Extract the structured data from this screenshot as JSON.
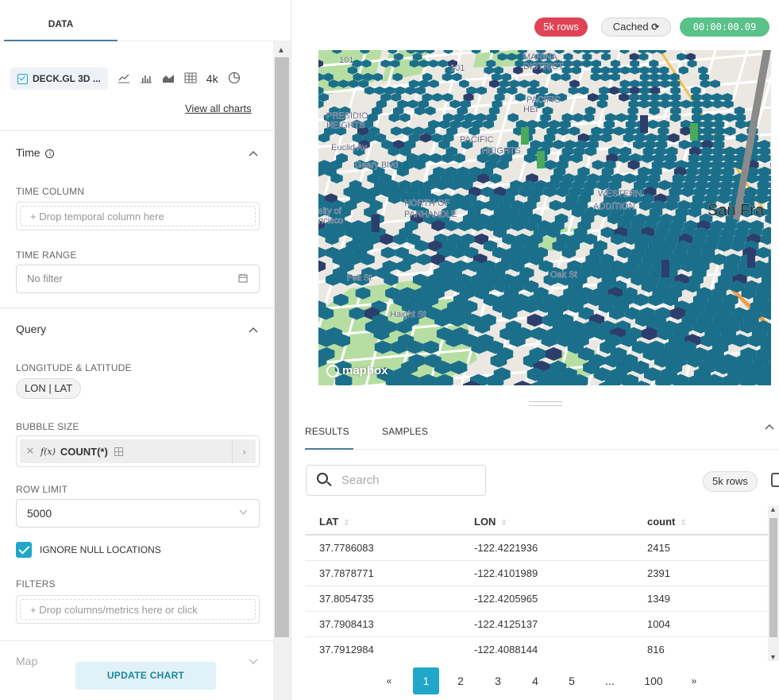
{
  "left_panel": {
    "tab_data": "DATA",
    "viz": {
      "selected": "DECK.GL 3D ...",
      "icons": [
        "line-chart-icon",
        "bar-chart-icon",
        "area-chart-icon",
        "table-icon",
        "pie-chart-icon"
      ],
      "big_number_label": "4k",
      "view_all": "View all charts"
    },
    "sections": {
      "time": {
        "title": "Time",
        "time_column_label": "TIME COLUMN",
        "time_column_placeholder": "+ Drop temporal column here",
        "time_range_label": "TIME RANGE",
        "time_range_value": "No filter"
      },
      "query": {
        "title": "Query",
        "lonlat_label": "LONGITUDE & LATITUDE",
        "lonlat_value": "LON | LAT",
        "bubble_size_label": "BUBBLE SIZE",
        "bubble_size_value": "COUNT(*)",
        "bubble_fx": "f(x)",
        "row_limit_label": "ROW LIMIT",
        "row_limit_value": "5000",
        "ignore_null_label": "IGNORE NULL LOCATIONS",
        "ignore_null_checked": true,
        "filters_label": "FILTERS",
        "filters_placeholder": "+ Drop columns/metrics here or click"
      },
      "map": {
        "title": "Map"
      }
    },
    "update_button": "UPDATE CHART"
  },
  "status": {
    "rows": "5k rows",
    "cached": "Cached",
    "elapsed": "00:00:00.09"
  },
  "map": {
    "attribution": "mapbox",
    "labels": [
      {
        "text": "MARINA"
      },
      {
        "text": "DISTRICT"
      },
      {
        "text": "PACIFIC"
      },
      {
        "text": "HEI"
      },
      {
        "text": "PRESIDIO"
      },
      {
        "text": "HEIGHTS"
      },
      {
        "text": "PACIFIC"
      },
      {
        "text": "HEIGHTS"
      },
      {
        "text": "NORTH OF"
      },
      {
        "text": "PANHANDLE"
      },
      {
        "text": "WESTERN"
      },
      {
        "text": "ADDITION"
      },
      {
        "text": "San Fra"
      },
      {
        "text": "sity of"
      },
      {
        "text": "ncisco"
      },
      {
        "text": "Fell St"
      },
      {
        "text": "Oak St"
      },
      {
        "text": "Haight St"
      },
      {
        "text": "Euclid Av"
      },
      {
        "text": "Geary Blvd"
      },
      {
        "text": "101"
      },
      {
        "text": "101"
      }
    ],
    "colors": {
      "hex": "#1b6f8a",
      "hex_dark": "#2c3e6b",
      "park": "#b7dea2",
      "water": "#b4d3e3",
      "base": "#ebe8e2"
    }
  },
  "results": {
    "tab_results": "RESULTS",
    "tab_samples": "SAMPLES",
    "search_placeholder": "Search",
    "rows_pill": "5k rows",
    "columns": [
      "LAT",
      "LON",
      "count"
    ],
    "rows": [
      [
        "37.7786083",
        "-122.4221936",
        "2415"
      ],
      [
        "37.7878771",
        "-122.4101989",
        "2391"
      ],
      [
        "37.8054735",
        "-122.4205965",
        "1349"
      ],
      [
        "37.7908413",
        "-122.4125137",
        "1004"
      ],
      [
        "37.7912984",
        "-122.4088144",
        "816"
      ]
    ],
    "pager": {
      "prev": "«",
      "pages": [
        "1",
        "2",
        "3",
        "4",
        "5",
        "...",
        "100"
      ],
      "next": "»",
      "active": "1"
    }
  }
}
